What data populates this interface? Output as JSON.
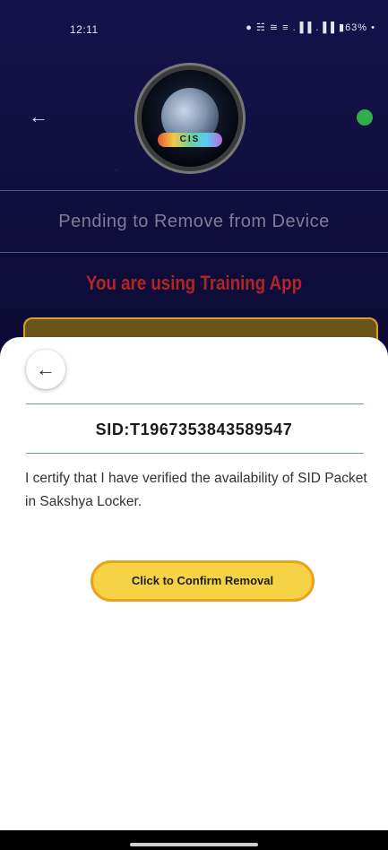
{
  "status_bar": {
    "time": "12:11",
    "icons_text": "● ☵ ≅ ≡ .▐▐ .▐▐ ▮63% •"
  },
  "header": {
    "back_icon": "arrow-left-icon",
    "logo_text": "CIS",
    "status_dot_color": "#2fae4b"
  },
  "page": {
    "heading": "Pending to Remove from Device",
    "training_notice": "You are using Training App",
    "notice_color": "#b02525"
  },
  "sheet": {
    "back_icon": "arrow-left-icon",
    "sid": "SID:T1967353843589547",
    "certify_text": "I certify that I have verified the availability of SID Packet in Sakshya Locker.",
    "confirm_button_label": "Click to Confirm Removal",
    "button_color": "#f5d344",
    "button_border_color": "#ee9f1b"
  }
}
